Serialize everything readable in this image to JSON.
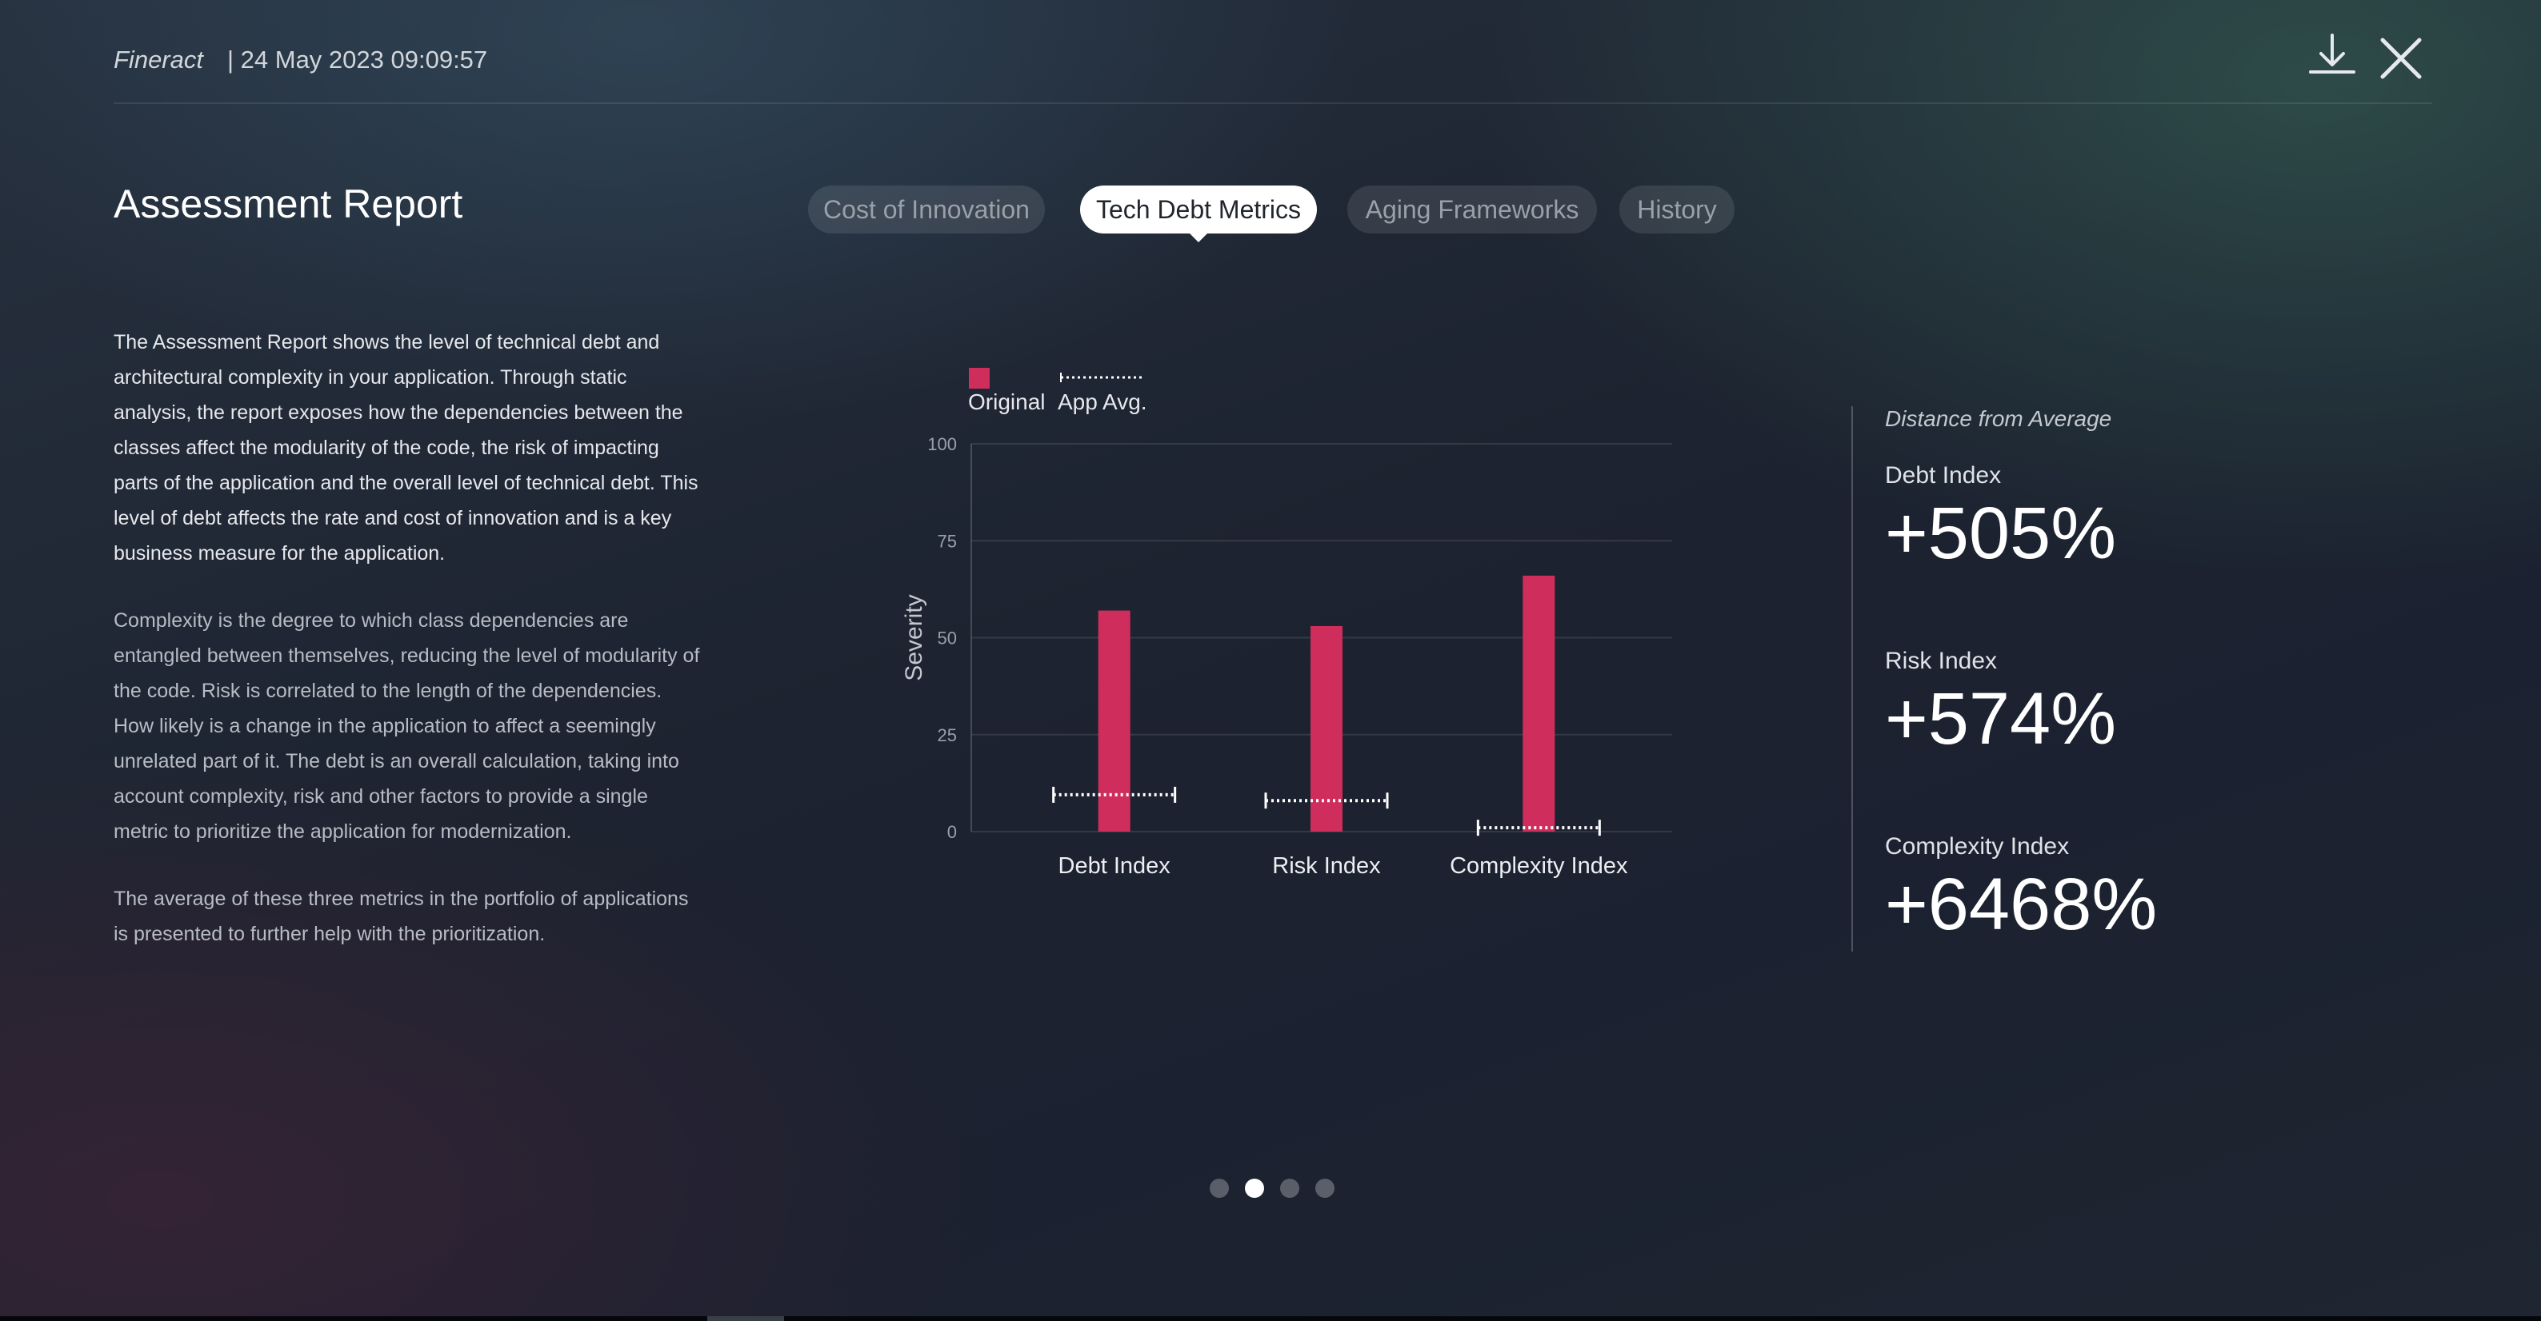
{
  "header": {
    "brand": "Fineract",
    "datetime": "| 24 May 2023 09:09:57",
    "download_icon": "download-icon",
    "close_icon": "close-icon"
  },
  "page": {
    "title": "Assessment Report"
  },
  "tabs": [
    {
      "label": "Cost of Innovation",
      "active": false
    },
    {
      "label": "Tech Debt Metrics",
      "active": true
    },
    {
      "label": "Aging Frameworks",
      "active": false
    },
    {
      "label": "History",
      "active": false
    }
  ],
  "description": [
    "The Assessment Report shows the level of technical debt and architectural complexity in your application. Through static analysis, the report exposes how the dependencies between the classes affect the modularity of the code, the risk of impacting parts of the application and the overall level of technical debt. This level of debt affects the rate and cost of innovation and is a key business measure for the application.",
    "Complexity is the degree to which class dependencies are entangled between themselves, reducing the level of modularity of the code. Risk is correlated to the length of the dependencies. How likely is a change in the application to affect a seemingly unrelated part of it. The debt is an overall calculation, taking into account complexity, risk and other factors to provide a single metric to prioritize the application for modernization.",
    "The average of these three metrics in the portfolio of applications is presented to further help with the prioritization."
  ],
  "chart_data": {
    "type": "bar",
    "categories": [
      "Debt Index",
      "Risk Index",
      "Complexity Index"
    ],
    "series": [
      {
        "name": "Original",
        "values": [
          57,
          53,
          66
        ],
        "color": "#cf2e5c"
      },
      {
        "name": "App Avg.",
        "values": [
          9.5,
          8,
          1
        ],
        "style": "dotted-marker",
        "color": "#ffffff"
      }
    ],
    "ylabel": "Severity",
    "xlabel": "",
    "ylim": [
      0,
      100
    ],
    "yticks": [
      0,
      25,
      50,
      75,
      100
    ],
    "grid": true,
    "legend": "top-left"
  },
  "stats": {
    "heading": "Distance from Average",
    "items": [
      {
        "label": "Debt Index",
        "value": "+505%"
      },
      {
        "label": "Risk Index",
        "value": "+574%"
      },
      {
        "label": "Complexity Index",
        "value": "+6468%"
      }
    ]
  },
  "pager": {
    "count": 4,
    "active_index": 1
  }
}
